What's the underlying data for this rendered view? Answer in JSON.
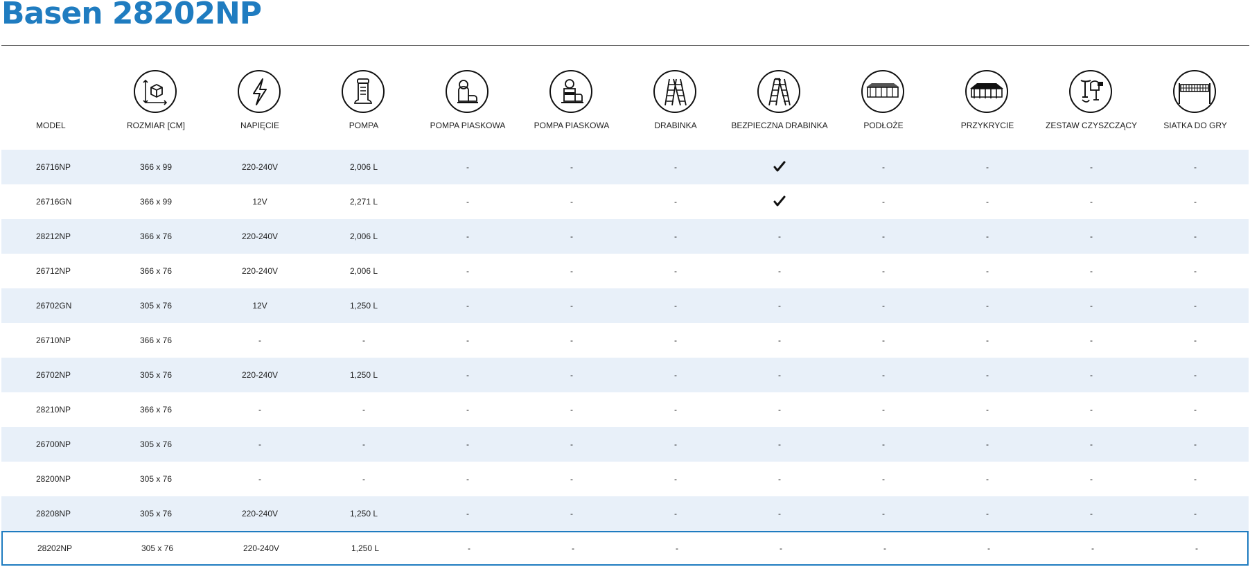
{
  "page": {
    "title": "Basen 28202NP"
  },
  "table": {
    "columns": [
      {
        "key": "model",
        "label": "MODEL",
        "icon": ""
      },
      {
        "key": "size",
        "label": "ROZMIAR [CM]",
        "icon": "dimensions-cube-icon"
      },
      {
        "key": "voltage",
        "label": "NAPIĘCIE",
        "icon": "lightning-bolt-icon"
      },
      {
        "key": "pump",
        "label": "POMPA",
        "icon": "cartridge-filter-pump-icon"
      },
      {
        "key": "sand_pump_1",
        "label": "POMPA PIASKOWA",
        "icon": "sand-filter-pump-icon"
      },
      {
        "key": "sand_pump_2",
        "label": "POMPA PIASKOWA",
        "icon": "combo-sand-filter-pump-icon"
      },
      {
        "key": "ladder",
        "label": "DRABINKA",
        "icon": "ladder-icon"
      },
      {
        "key": "safety_ladder",
        "label": "BEZPIECZNA DRABINKA",
        "icon": "safety-ladder-icon"
      },
      {
        "key": "ground_cloth",
        "label": "PODŁOŻE",
        "icon": "ground-cloth-icon"
      },
      {
        "key": "cover",
        "label": "PRZYKRYCIE",
        "icon": "pool-cover-icon"
      },
      {
        "key": "cleaning_kit",
        "label": "ZESTAW CZYSZCZĄCY",
        "icon": "cleaning-kit-icon"
      },
      {
        "key": "net",
        "label": "SIATKA DO GRY",
        "icon": "volleyball-net-icon"
      }
    ],
    "rows": [
      [
        "26716NP",
        "366 x 99",
        "220-240V",
        "2,006 L",
        "-",
        "-",
        "-",
        "✔",
        "-",
        "-",
        "-",
        "-"
      ],
      [
        "26716GN",
        "366 x 99",
        "12V",
        "2,271 L",
        "-",
        "-",
        "-",
        "✔",
        "-",
        "-",
        "-",
        "-"
      ],
      [
        "28212NP",
        "366 x 76",
        "220-240V",
        "2,006 L",
        "-",
        "-",
        "-",
        "-",
        "-",
        "-",
        "-",
        "-"
      ],
      [
        "26712NP",
        "366 x 76",
        "220-240V",
        "2,006 L",
        "-",
        "-",
        "-",
        "-",
        "-",
        "-",
        "-",
        "-"
      ],
      [
        "26702GN",
        "305 x 76",
        "12V",
        "1,250 L",
        "-",
        "-",
        "-",
        "-",
        "-",
        "-",
        "-",
        "-"
      ],
      [
        "26710NP",
        "366 x 76",
        "-",
        "-",
        "-",
        "-",
        "-",
        "-",
        "-",
        "-",
        "-",
        "-"
      ],
      [
        "26702NP",
        "305 x 76",
        "220-240V",
        "1,250 L",
        "-",
        "-",
        "-",
        "-",
        "-",
        "-",
        "-",
        "-"
      ],
      [
        "28210NP",
        "366 x 76",
        "-",
        "-",
        "-",
        "-",
        "-",
        "-",
        "-",
        "-",
        "-",
        "-"
      ],
      [
        "26700NP",
        "305 x 76",
        "-",
        "-",
        "-",
        "-",
        "-",
        "-",
        "-",
        "-",
        "-",
        "-"
      ],
      [
        "28200NP",
        "305 x 76",
        "-",
        "-",
        "-",
        "-",
        "-",
        "-",
        "-",
        "-",
        "-",
        "-"
      ],
      [
        "28208NP",
        "305 x 76",
        "220-240V",
        "1,250 L",
        "-",
        "-",
        "-",
        "-",
        "-",
        "-",
        "-",
        "-"
      ],
      [
        "28202NP",
        "305 x 76",
        "220-240V",
        "1,250 L",
        "-",
        "-",
        "-",
        "-",
        "-",
        "-",
        "-",
        "-"
      ]
    ],
    "selected_model": "28202NP"
  },
  "colors": {
    "accent": "#1f7cc0",
    "row_alt": "#e8f0f9",
    "text": "#1f1f1f"
  }
}
